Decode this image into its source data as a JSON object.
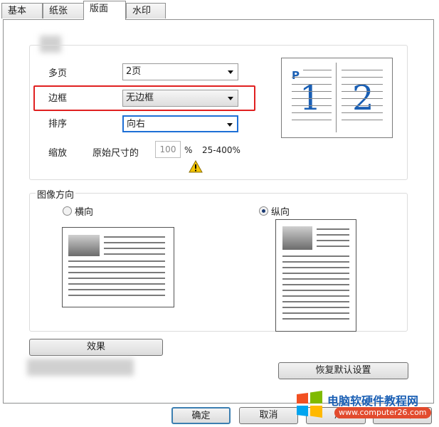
{
  "tabs": [
    "基本",
    "纸张",
    "版面",
    "水印"
  ],
  "active_tab": "版面",
  "layout": {
    "pages_per_sheet": {
      "label": "多页",
      "value": "2页"
    },
    "border": {
      "label": "边框",
      "value": "无边框"
    },
    "order": {
      "label": "排序",
      "value": "向右"
    },
    "scale": {
      "label": "缩放",
      "prefix": "原始尺寸的",
      "value": "100",
      "unit": "%",
      "range": "25-400%"
    }
  },
  "preview": {
    "letter": "P",
    "page1": "1",
    "page2": "2"
  },
  "orientation": {
    "title": "图像方向",
    "landscape": "横向",
    "portrait": "纵向",
    "selected": "纵向"
  },
  "buttons": {
    "effects": "效果",
    "restore_defaults": "恢复默认设置",
    "ok": "确定",
    "cancel": "取消",
    "apply": "用",
    "help": "帮助"
  },
  "watermark": {
    "title": "电脑软硬件教程网",
    "url": "www.computer26.com"
  },
  "colors": {
    "highlight": "#e02020",
    "selected_select": "#1e6fd6",
    "brand_blue": "#1a5fb4"
  }
}
